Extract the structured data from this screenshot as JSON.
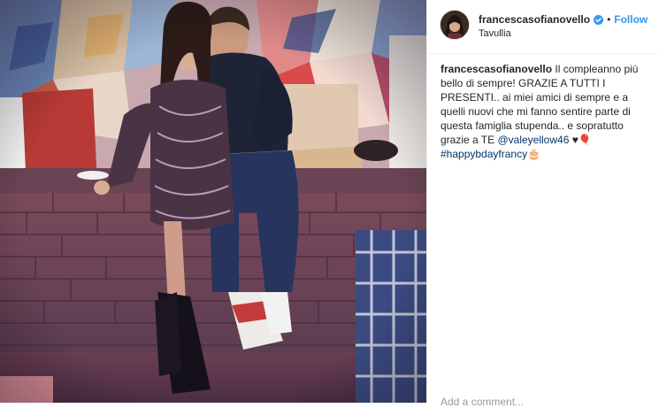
{
  "post": {
    "username": "francescasofianovello",
    "follow_label": "Follow",
    "separator": "•",
    "location": "Tavullia",
    "caption": {
      "username": "francescasofianovello",
      "text_1": "Il compleanno più bello di sempre! GRAZIE A TUTTI I PRESENTI.. ai miei amici di sempre e a quelli nuovi che mi fanno sentire parte di questa famiglia stupenda.. e sopratutto grazie a TE ",
      "mention": "@valeyellow46",
      "emoji_1": " ♥🎈",
      "hashtag": "#happybdayfrancy",
      "emoji_2": "🎂"
    },
    "add_comment_placeholder": "Add a comment..."
  },
  "colors": {
    "follow_blue": "#3897f0",
    "link_navy": "#003569",
    "verified_blue": "#3897f0"
  },
  "icons": [
    "verified-badge-icon"
  ]
}
